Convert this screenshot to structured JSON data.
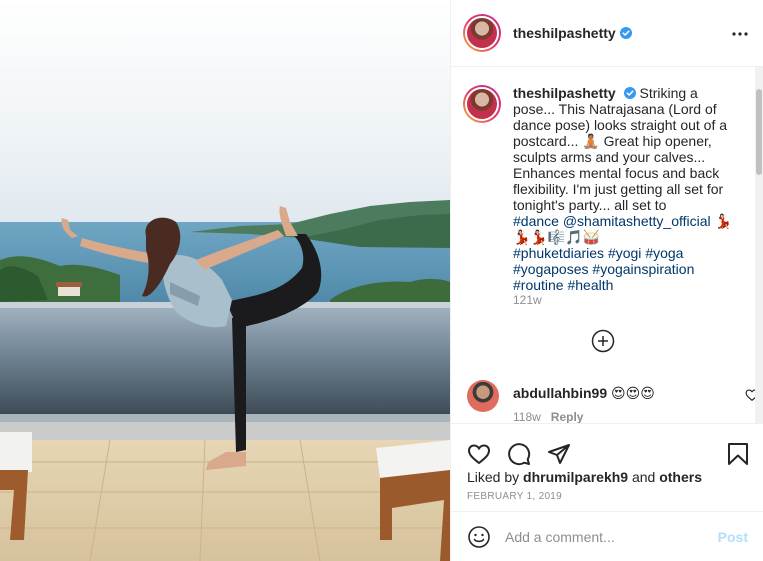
{
  "post": {
    "username": "theshilpashetty",
    "verified": true,
    "more_icon": "more-horizontal-icon"
  },
  "caption": {
    "username": "theshilpashetty",
    "text": "Striking a pose... This Natrajasana (Lord of dance pose) looks straight out of a postcard... 🧘🏽 Great hip opener, sculpts arms and your calves... Enhances mental focus and back flexibility. I'm just getting all set for tonight's party... all set to",
    "tags_line1": "#dance",
    "mention": "@shamitashetty_official",
    "emoji_line": "💃🏻💃🏻💃🏻🎼🎵🥁",
    "tags": [
      "#phuketdiaries",
      "#yogi",
      "#yoga",
      "#yogaposes",
      "#yogainspiration",
      "#routine",
      "#health"
    ],
    "time": "121w"
  },
  "comments": [
    {
      "username": "abdullahbin99",
      "text": "😍😍😍",
      "time": "118w",
      "reply_label": "Reply"
    }
  ],
  "actions": {
    "icons": [
      "heart-icon",
      "comment-icon",
      "share-icon",
      "bookmark-icon"
    ]
  },
  "likes": {
    "prefix": "Liked by",
    "user": "dhrumilparekh9",
    "joiner": "and",
    "others": "others"
  },
  "date": "FEBRUARY 1, 2019",
  "add_comment": {
    "placeholder": "Add a comment...",
    "post_label": "Post"
  },
  "colors": {
    "link": "#00376b",
    "verified": "#3897f0",
    "muted": "#8e8e8e",
    "post_disabled": "#b2dffc"
  }
}
